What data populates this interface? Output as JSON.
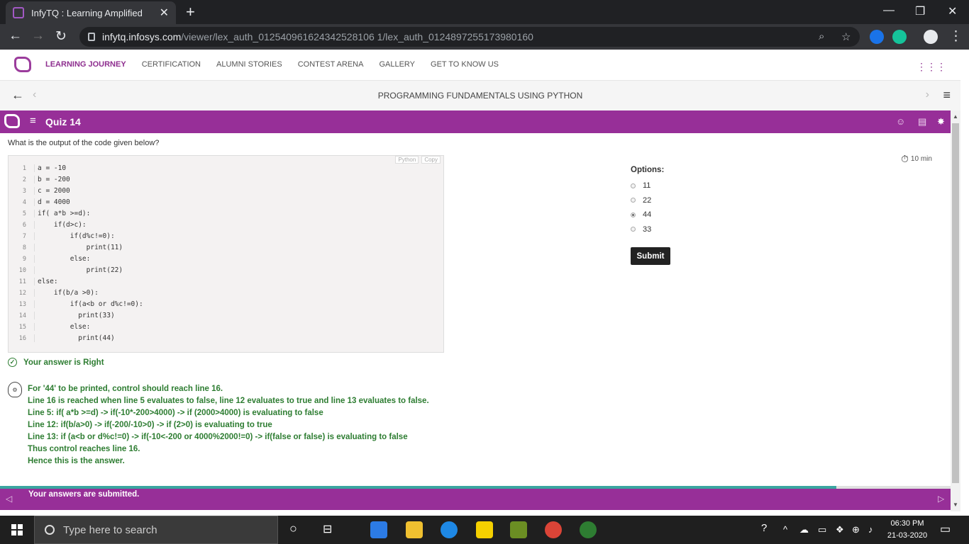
{
  "browser": {
    "tab_title": "InfyTQ : Learning Amplified",
    "url_host": "infytq.infosys.com",
    "url_path": "/viewer/lex_auth_012540961624342528106 1/lex_auth_0124897255173980160"
  },
  "nav": {
    "items": [
      "LEARNING JOURNEY",
      "CERTIFICATION",
      "ALUMNI STORIES",
      "CONTEST ARENA",
      "GALLERY",
      "GET TO KNOW US"
    ]
  },
  "course": {
    "title": "PROGRAMMING FUNDAMENTALS USING PYTHON"
  },
  "quiz": {
    "title": "Quiz 14",
    "question": "What is the output of the code given below?",
    "code_tools": [
      "Python",
      "Copy"
    ],
    "code": [
      "a = -10",
      "b = -200",
      "c = 2000",
      "d = 4000",
      "if( a*b >=d):",
      "    if(d>c):",
      "        if(d%c!=0):",
      "            print(11)",
      "        else:",
      "            print(22)",
      "else:",
      "    if(b/a >0):",
      "        if(a<b or d%c!=0):",
      "          print(33)",
      "        else:",
      "          print(44)"
    ],
    "line_numbers": [
      "1",
      "2",
      "3",
      "4",
      "5",
      "6",
      "7",
      "8",
      "9",
      "10",
      "11",
      "12",
      "13",
      "14",
      "15",
      "16"
    ],
    "timer": "10 min",
    "options_label": "Options:",
    "options": [
      "11",
      "22",
      "44",
      "33"
    ],
    "selected_option": "44",
    "submit_label": "Submit",
    "result": "Your answer is Right",
    "explanation": [
      "For '44' to be printed, control should reach line 16.",
      "Line 16 is reached when line 5 evaluates to false, line 12 evaluates to true and line 13 evaluates to false.",
      "Line 5: if( a*b >=d) -> if(-10*-200>4000) -> if (2000>4000) is evaluating to false",
      "Line 12: if(b/a>0) -> if(-200/-10>0) -> if (2>0) is evaluating to true",
      "Line 13: if (a<b or d%c!=0) -> if(-10<-200 or 4000%2000!=0) -> if(false or false) is evaluating to false",
      "Thus control reaches line 16.",
      "Hence this is the answer."
    ],
    "progress": 0.88
  },
  "footer": {
    "message": "Your answers are submitted."
  },
  "taskbar": {
    "search_placeholder": "Type here to search",
    "time": "06:30 PM",
    "date": "21-03-2020"
  },
  "colors": {
    "brand": "#972f98",
    "success": "#2e7d32"
  }
}
